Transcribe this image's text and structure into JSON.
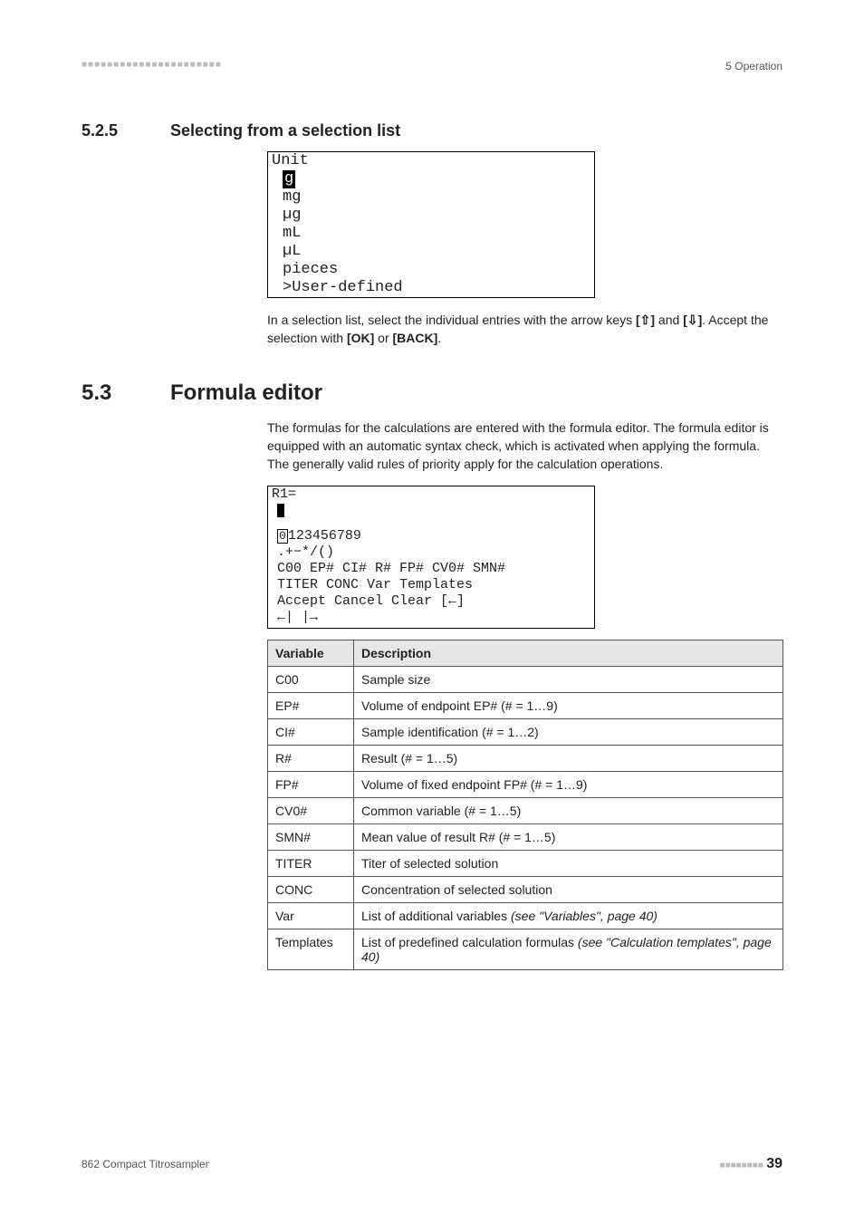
{
  "topbar": {
    "chapter": "5 Operation"
  },
  "sec525": {
    "num": "5.2.5",
    "title": "Selecting from a selection list"
  },
  "selbox": {
    "header": "Unit",
    "selected": "g",
    "items": [
      "mg",
      "µg",
      "mL",
      "µL",
      "pieces",
      ">User-defined"
    ]
  },
  "selpara": {
    "t1": "In a selection list, select the individual entries with the arrow keys ",
    "k1": "[⇧]",
    "t2": " and ",
    "k2": "[⇩]",
    "t3": ". Accept the selection with ",
    "k3": "[OK]",
    "t4": " or ",
    "k4": "[BACK]",
    "t5": "."
  },
  "sec53": {
    "num": "5.3",
    "title": "Formula editor"
  },
  "fpara": "The formulas for the calculations are entered with the formula editor. The formula editor is equipped with an automatic syntax check, which is activated when applying the formula. The generally valid rules of priority apply for the calculation operations.",
  "formula": {
    "header": "R1=",
    "numrow_lead": "0",
    "numrow_rest": "123456789",
    "ops": ".+−*/()",
    "vars": "C00 EP# CI# R# FP# CV0# SMN#",
    "more": "TITER CONC Var Templates",
    "accept": "Accept Cancel Clear [←]",
    "arrows": "←| |→"
  },
  "table": {
    "h1": "Variable",
    "h2": "Description",
    "rows": [
      {
        "v": "C00",
        "d": "Sample size"
      },
      {
        "v": "EP#",
        "d": "Volume of endpoint EP# (# = 1…9)"
      },
      {
        "v": "CI#",
        "d": "Sample identification (# = 1…2)"
      },
      {
        "v": "R#",
        "d": "Result (# = 1…5)"
      },
      {
        "v": "FP#",
        "d": "Volume of fixed endpoint FP# (# = 1…9)"
      },
      {
        "v": "CV0#",
        "d": "Common variable (# = 1…5)"
      },
      {
        "v": "SMN#",
        "d": "Mean value of result R# (# = 1…5)"
      },
      {
        "v": "TITER",
        "d": "Titer of selected solution"
      },
      {
        "v": "CONC",
        "d": "Concentration of selected solution"
      },
      {
        "v": "Var",
        "d_pre": "List of additional variables ",
        "d_it": "(see \"Variables\", page 40)"
      },
      {
        "v": "Templates",
        "d_pre": "List of predefined calculation formulas ",
        "d_it": "(see \"Calculation templates\", page 40)"
      }
    ]
  },
  "footer": {
    "left": "862 Compact Titrosampler",
    "page": "39"
  }
}
